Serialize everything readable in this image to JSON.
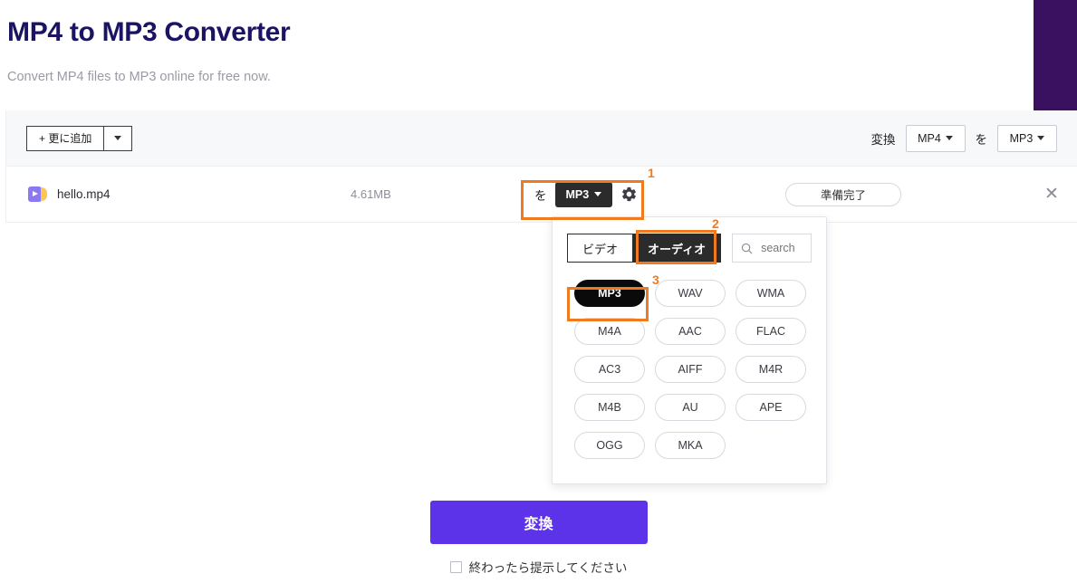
{
  "header": {
    "title": "MP4 to MP3 Converter",
    "subtitle": "Convert MP4 files to MP3 online for free now."
  },
  "toolbar": {
    "add_more_label": "+ 更に追加",
    "add_more_caret_icon": "chevron-down-icon",
    "convert_label": "変換",
    "source_format": "MP4",
    "to_label": "を",
    "target_format": "MP3"
  },
  "file_row": {
    "icon": "video-file-icon",
    "name": "hello.mp4",
    "size": "4.61MB",
    "to_label": "を",
    "format": "MP3",
    "settings_icon": "gear-icon",
    "status": "準備完了",
    "close_icon": "close-icon"
  },
  "format_panel": {
    "tabs": [
      {
        "label": "ビデオ",
        "active": false
      },
      {
        "label": "オーディオ",
        "active": true
      }
    ],
    "search": {
      "icon": "search-icon",
      "placeholder": "search",
      "value": ""
    },
    "formats": [
      {
        "label": "MP3",
        "selected": true
      },
      {
        "label": "WAV",
        "selected": false
      },
      {
        "label": "WMA",
        "selected": false
      },
      {
        "label": "M4A",
        "selected": false
      },
      {
        "label": "AAC",
        "selected": false
      },
      {
        "label": "FLAC",
        "selected": false
      },
      {
        "label": "AC3",
        "selected": false
      },
      {
        "label": "AIFF",
        "selected": false
      },
      {
        "label": "M4R",
        "selected": false
      },
      {
        "label": "M4B",
        "selected": false
      },
      {
        "label": "AU",
        "selected": false
      },
      {
        "label": "APE",
        "selected": false
      },
      {
        "label": "OGG",
        "selected": false
      },
      {
        "label": "MKA",
        "selected": false
      }
    ]
  },
  "footer": {
    "convert_button": "変換",
    "notify_label": "終わったら提示してください",
    "notify_checked": false
  },
  "annotations": [
    {
      "number": "1",
      "target": "row-format-selector"
    },
    {
      "number": "2",
      "target": "audio-tab"
    },
    {
      "number": "3",
      "target": "mp3-format-pill"
    }
  ],
  "colors": {
    "title": "#1b1464",
    "accent_purple": "#5c33e8",
    "band_purple": "#3a1060",
    "annotation_orange": "#f07a20",
    "dark_button": "#2b2b2b"
  }
}
